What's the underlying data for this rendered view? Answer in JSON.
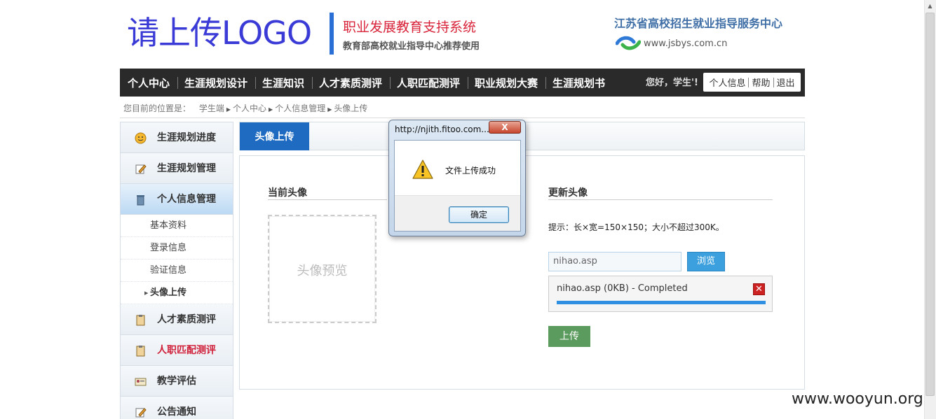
{
  "header": {
    "logo": "请上传LOGO",
    "system_title": "职业发展教育支持系统",
    "system_subtitle": "教育部高校就业指导中心推荐使用",
    "center_name": "江苏省高校招生就业指导服务中心",
    "center_url": "www.jsbys.com.cn"
  },
  "nav": {
    "items": [
      "个人中心",
      "生涯规划设计",
      "生涯知识",
      "人才素质测评",
      "人职匹配测评",
      "职业规划大赛",
      "生涯规划书"
    ],
    "greeting": "您好，学生'!",
    "links": [
      "个人信息",
      "帮助",
      "退出"
    ]
  },
  "breadcrumb": {
    "prefix": "您目前的位置是：",
    "items": [
      "学生端",
      "个人中心",
      "个人信息管理",
      "头像上传"
    ]
  },
  "sidebar": {
    "items": [
      {
        "label": "生涯规划进度",
        "icon": "smiley-icon"
      },
      {
        "label": "生涯规划管理",
        "icon": "edit-icon"
      },
      {
        "label": "个人信息管理",
        "icon": "trash-icon"
      }
    ],
    "subitems": [
      "基本资料",
      "登录信息",
      "验证信息",
      "头像上传"
    ],
    "items2": [
      {
        "label": "人才素质测评",
        "icon": "clipboard-icon"
      },
      {
        "label": "人职匹配测评",
        "icon": "clipboard-icon"
      },
      {
        "label": "教学评估",
        "icon": "id-card-icon"
      },
      {
        "label": "公告通知",
        "icon": "edit-icon"
      }
    ]
  },
  "main": {
    "tab": "头像上传",
    "current_avatar_title": "当前头像",
    "preview_placeholder": "头像预览",
    "update_avatar_title": "更新头像",
    "tip": "提示：长×宽=150×150；大小不超过300K。",
    "file_value": "nihao.asp",
    "browse_label": "浏览",
    "upload_status": "nihao.asp (0KB) - Completed",
    "upload_progress": 1.0,
    "upload_label": "上传"
  },
  "dialog": {
    "title": "http://njith.fitoo.com...",
    "close_label": "X",
    "message": "文件上传成功",
    "ok_label": "确定"
  },
  "watermark": "www.wooyun.org"
}
